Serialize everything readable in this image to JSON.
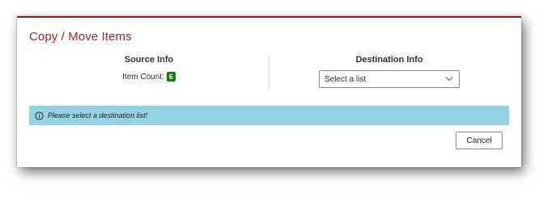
{
  "dialog": {
    "title": "Copy / Move Items",
    "accent_color": "#a4262c"
  },
  "source": {
    "heading": "Source Info",
    "item_count_label": "Item Count:",
    "item_count": "6",
    "badge_color": "#107c10"
  },
  "destination": {
    "heading": "Destination Info",
    "select": {
      "selected": "Select a list",
      "icon": "chevron-down-icon"
    }
  },
  "info_bar": {
    "icon": "info-icon",
    "message": "Please select a destination list!",
    "background": "#94d3e5"
  },
  "footer": {
    "cancel_label": "Cancel"
  }
}
